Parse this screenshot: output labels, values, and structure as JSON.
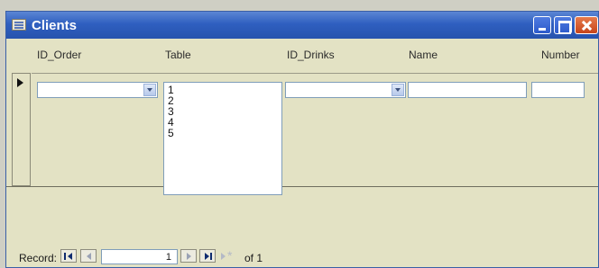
{
  "window": {
    "title": "Clients"
  },
  "columns": {
    "id_order": "ID_Order",
    "table": "Table",
    "id_drinks": "ID_Drinks",
    "name": "Name",
    "number": "Number"
  },
  "table_list": {
    "items": [
      "1",
      "2",
      "3",
      "4",
      "5"
    ]
  },
  "fields": {
    "id_order_value": "",
    "id_drinks_value": "",
    "name_value": "",
    "number_value": ""
  },
  "navigation": {
    "record_label": "Record:",
    "current_record": "1",
    "of_text": "of 1"
  }
}
